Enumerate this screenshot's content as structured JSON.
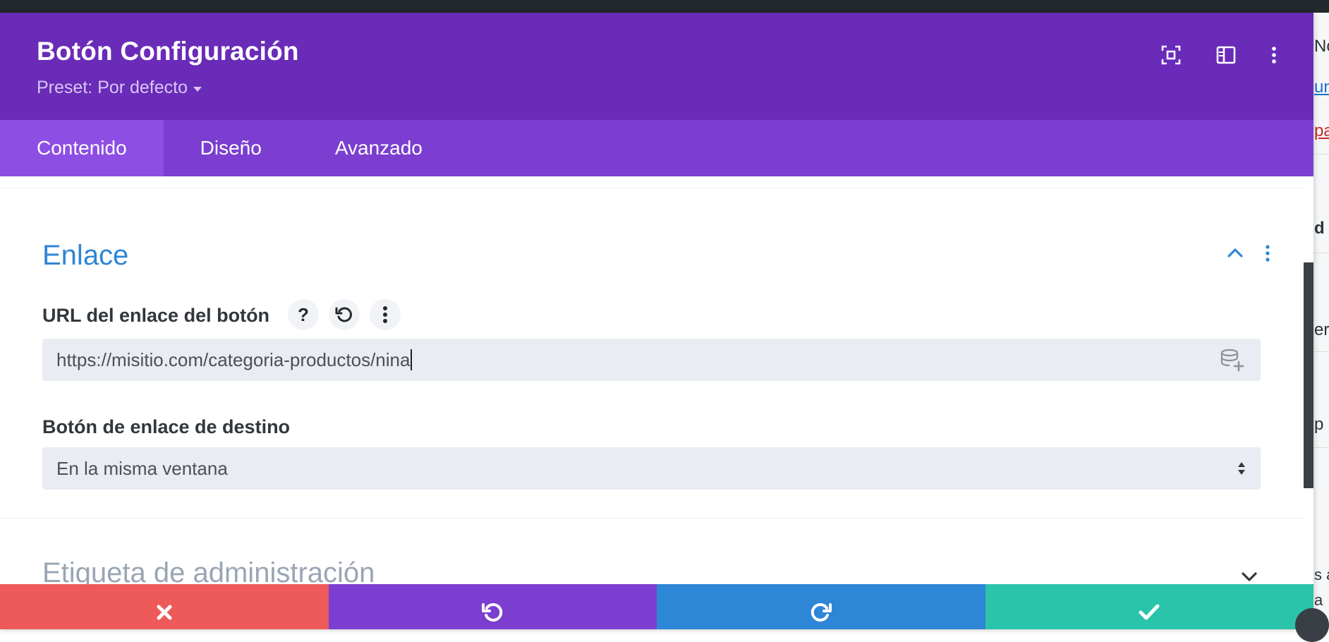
{
  "colors": {
    "header_bg": "#6a2bb8",
    "tabs_bg": "#7b3ed0",
    "tab_active_bg": "#8d4ee4",
    "section_title": "#2e86d6",
    "cancel": "#ee5a5a",
    "undo": "#7b3ed0",
    "redo": "#2e86d6",
    "save": "#29c4a9"
  },
  "modal": {
    "title": "Botón Configuración",
    "preset_label": "Preset: Por defecto",
    "header_icons": [
      "focus-mode-icon",
      "layout-columns-icon",
      "more-vertical-icon"
    ]
  },
  "tabs": [
    {
      "label": "Contenido",
      "active": true
    },
    {
      "label": "Diseño",
      "active": false
    },
    {
      "label": "Avanzado",
      "active": false
    }
  ],
  "section": {
    "title": "Enlace",
    "expanded": true
  },
  "url_field": {
    "label": "URL del enlace del botón",
    "value": "https://misitio.com/categoria-productos/nina",
    "help_glyph": "?"
  },
  "target_field": {
    "label": "Botón de enlace de destino",
    "value": "En la misma ventana"
  },
  "section2": {
    "title": "Etiqueta de administración",
    "expanded": false
  },
  "footer": {
    "buttons": [
      "cancel-icon",
      "undo-icon",
      "redo-icon",
      "check-icon"
    ]
  },
  "background_page": {
    "fragments": [
      "No",
      "un",
      "pa",
      "d",
      "er",
      "p",
      "s a",
      "a"
    ]
  }
}
